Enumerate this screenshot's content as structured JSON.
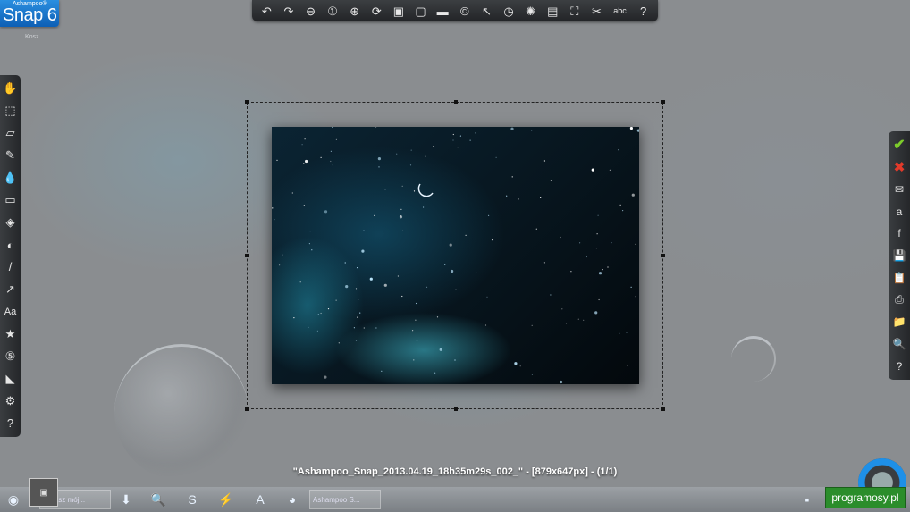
{
  "logo": {
    "brand": "Ashampoo®",
    "name": "Snap 6"
  },
  "desktop": {
    "label": "Kosz"
  },
  "top_toolbar": {
    "items": [
      {
        "name": "undo-icon",
        "glyph": "↶"
      },
      {
        "name": "redo-icon",
        "glyph": "↷"
      },
      {
        "name": "zoom-out-icon",
        "glyph": "⊖"
      },
      {
        "name": "zoom-actual-icon",
        "glyph": "①"
      },
      {
        "name": "zoom-in-icon",
        "glyph": "⊕"
      },
      {
        "name": "rotate-icon",
        "glyph": "⟳"
      },
      {
        "name": "image-icon",
        "glyph": "▣"
      },
      {
        "name": "crop-icon",
        "glyph": "▢"
      },
      {
        "name": "border-icon",
        "glyph": "▬"
      },
      {
        "name": "copyright-icon",
        "glyph": "©"
      },
      {
        "name": "cursor-icon",
        "glyph": "↖"
      },
      {
        "name": "clock-icon",
        "glyph": "◷"
      },
      {
        "name": "effects-icon",
        "glyph": "✺"
      },
      {
        "name": "bucket-icon",
        "glyph": "▤"
      },
      {
        "name": "fit-screen-icon",
        "glyph": "⛶"
      },
      {
        "name": "cut-icon",
        "glyph": "✂"
      },
      {
        "name": "spellcheck-icon",
        "glyph": "abc"
      },
      {
        "name": "help-icon",
        "glyph": "?"
      }
    ]
  },
  "left_toolbar": {
    "items": [
      {
        "name": "hand-tool-icon",
        "glyph": "✋"
      },
      {
        "name": "selection-tool-icon",
        "glyph": "⬚"
      },
      {
        "name": "eraser-icon",
        "glyph": "▱"
      },
      {
        "name": "pencil-icon",
        "glyph": "✎"
      },
      {
        "name": "blur-drop-icon",
        "glyph": "💧"
      },
      {
        "name": "highlight-icon",
        "glyph": "▭"
      },
      {
        "name": "fill-bucket-icon",
        "glyph": "◈"
      },
      {
        "name": "shapes-icon",
        "glyph": "◐"
      },
      {
        "name": "brush-icon",
        "glyph": "/"
      },
      {
        "name": "arrow-tool-icon",
        "glyph": "↗"
      },
      {
        "name": "text-tool-icon",
        "glyph": "Aa"
      },
      {
        "name": "stamps-icon",
        "glyph": "★"
      },
      {
        "name": "numbering-icon",
        "glyph": "⑤"
      },
      {
        "name": "ruler-icon",
        "glyph": "◣"
      },
      {
        "name": "settings-icon",
        "glyph": "⚙"
      },
      {
        "name": "help-icon",
        "glyph": "?"
      }
    ]
  },
  "right_toolbar": {
    "items": [
      {
        "name": "confirm-icon",
        "glyph": "✔"
      },
      {
        "name": "cancel-icon",
        "glyph": "✖"
      },
      {
        "name": "email-icon",
        "glyph": "✉"
      },
      {
        "name": "web-upload-icon",
        "glyph": "a"
      },
      {
        "name": "facebook-icon",
        "glyph": "f"
      },
      {
        "name": "save-icon",
        "glyph": "💾"
      },
      {
        "name": "clipboard-icon",
        "glyph": "📋"
      },
      {
        "name": "print-icon",
        "glyph": "⎙"
      },
      {
        "name": "folder-icon",
        "glyph": "📁"
      },
      {
        "name": "search-folder-icon",
        "glyph": "🔍"
      },
      {
        "name": "help-icon",
        "glyph": "?"
      }
    ]
  },
  "caption": "\"Ashampoo_Snap_2013.04.19_18h35m29s_002_\" - [879x647px] - (1/1)",
  "taskbar": {
    "window_1": "Lukasz mój...",
    "window_2": "Ashampoo S..."
  },
  "watermark": "programosy.pl"
}
